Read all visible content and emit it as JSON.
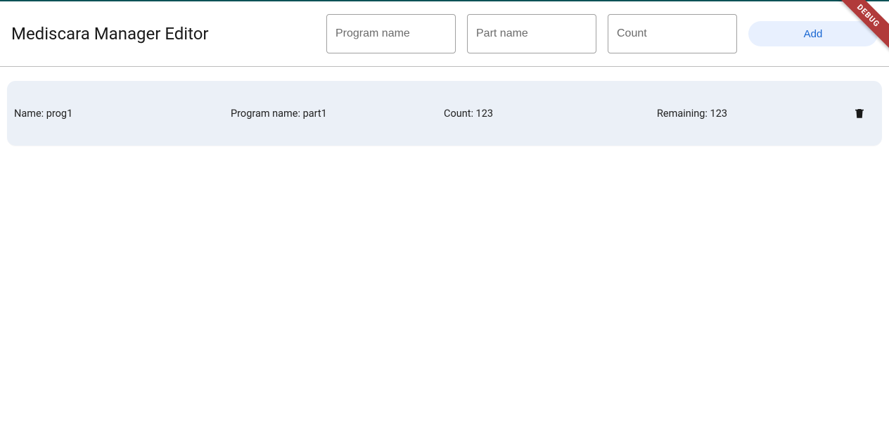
{
  "header": {
    "title": "Mediscara Manager Editor",
    "program_name_placeholder": "Program name",
    "part_name_placeholder": "Part name",
    "count_placeholder": "Count",
    "add_label": "Add"
  },
  "debug_ribbon_label": "DEBUG",
  "rows": [
    {
      "name_label": "Name: prog1",
      "program_label": "Program name: part1",
      "count_label": "Count: 123",
      "remaining_label": "Remaining: 123"
    }
  ]
}
